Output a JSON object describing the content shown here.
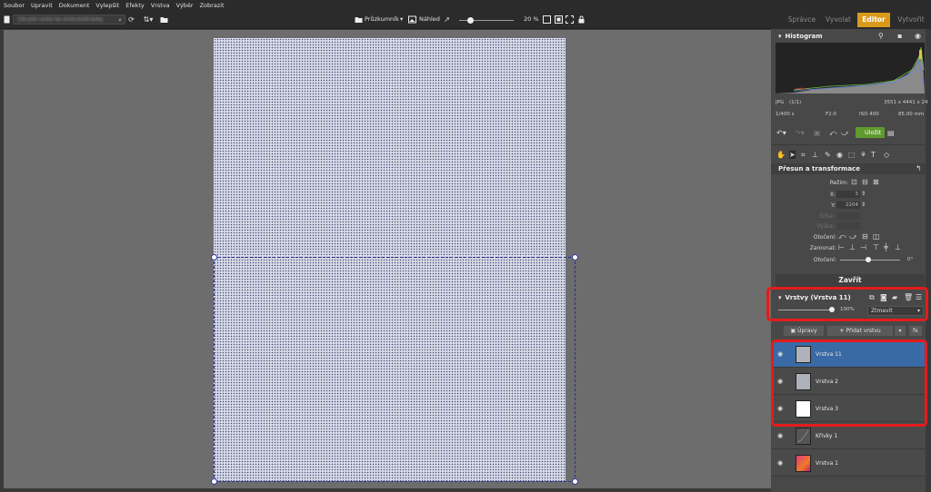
{
  "menu": [
    "Soubor",
    "Upravit",
    "Dokument",
    "Vylepšit",
    "Efekty",
    "Vrstva",
    "Výběr",
    "Zobrazit"
  ],
  "toolbar": {
    "path_text": "\\Skrytá cesta ke složce\\obrázky",
    "browser_label": "Průzkumník",
    "preview_label": "Náhled",
    "zoom_value": "20 %"
  },
  "mode_tabs": [
    "Správce",
    "Vyvolat",
    "Editor",
    "Vytvořit"
  ],
  "active_tab": "Editor",
  "histogram": {
    "title": "Histogram",
    "format": "JPG",
    "count": "(1/1)",
    "dimensions": "3551 x 4441 x 24",
    "shutter": "1/400 s",
    "aperture": "F2.0",
    "iso": "ISO 400",
    "focal": "85.00 mm"
  },
  "save_label": "Uložit",
  "transform": {
    "title": "Přesun a transformace",
    "mode_label": "Režim:",
    "x_label": "X:",
    "x_value": "3",
    "y_label": "Y:",
    "y_value": "2204",
    "width_label": "Šířka:",
    "height_label": "Výška:",
    "rotate_label": "Otočení:",
    "align_label": "Zarovnat:",
    "rotation_label": "Otočení:",
    "rotation_value": "0°",
    "close_label": "Zavřít"
  },
  "layers": {
    "title": "Vrstvy (Vrstva 11)",
    "opacity": "100%",
    "blend_mode": "Ztmavit",
    "adjust_label": "Úpravy",
    "add_label": "Přidat vrstvu",
    "fx_label": "fx",
    "items": [
      {
        "name": "Vrstva 11",
        "selected": true
      },
      {
        "name": "Vrstva 2",
        "selected": false
      },
      {
        "name": "Vrstva 3",
        "selected": false
      },
      {
        "name": "Křivky 1",
        "selected": false
      },
      {
        "name": "Vrstva 1",
        "selected": false
      }
    ]
  },
  "colors": {
    "accent_tab": "#d99a1b",
    "save_button": "#5f9a2e",
    "selected_layer": "#3a6aa5",
    "highlight_box": "#e51b1b"
  }
}
